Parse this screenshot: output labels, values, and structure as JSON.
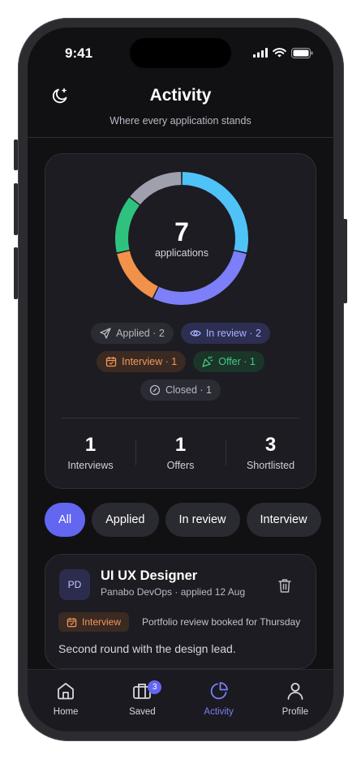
{
  "status_bar": {
    "time": "9:41"
  },
  "header": {
    "title": "Activity",
    "subtitle": "Where every application stands",
    "theme_icon": "moon-icon"
  },
  "chart_data": {
    "type": "pie",
    "donut": true,
    "total": 7,
    "center_value": "7",
    "center_label": "applications",
    "categories": [
      "Applied",
      "In review",
      "Interview",
      "Offer",
      "Closed"
    ],
    "values": [
      2,
      2,
      1,
      1,
      1
    ],
    "colors": [
      "#4fc3f7",
      "#7c7ff7",
      "#f2914a",
      "#2ec27e",
      "#9ea1ad"
    ]
  },
  "chips": [
    {
      "label": "Applied · 2",
      "icon": "send-icon"
    },
    {
      "label": "In review · 2",
      "icon": "eye-icon"
    },
    {
      "label": "Interview · 1",
      "icon": "calendar-icon"
    },
    {
      "label": "Offer · 1",
      "icon": "party-icon"
    },
    {
      "label": "Closed · 1",
      "icon": "slash-circle-icon"
    }
  ],
  "stats": [
    {
      "value": "1",
      "label": "Interviews"
    },
    {
      "value": "1",
      "label": "Offers"
    },
    {
      "value": "3",
      "label": "Shortlisted"
    }
  ],
  "filters": [
    "All",
    "Applied",
    "In review",
    "Interview"
  ],
  "active_filter": "All",
  "application": {
    "initials": "PD",
    "title": "UI UX Designer",
    "meta": "Panabo DevOps · applied 12 Aug",
    "status": "Interview",
    "note": "Portfolio review booked for Thursday",
    "description": "Second round with the design lead."
  },
  "tabbar": {
    "items": [
      {
        "label": "Home",
        "icon": "home-icon"
      },
      {
        "label": "Saved",
        "icon": "briefcase-icon",
        "badge": "3"
      },
      {
        "label": "Activity",
        "icon": "pie-chart-icon"
      },
      {
        "label": "Profile",
        "icon": "user-icon"
      }
    ],
    "active": "Activity"
  },
  "colors": {
    "accent": "#6366f1",
    "background": "#111114",
    "card": "#1c1c22"
  }
}
